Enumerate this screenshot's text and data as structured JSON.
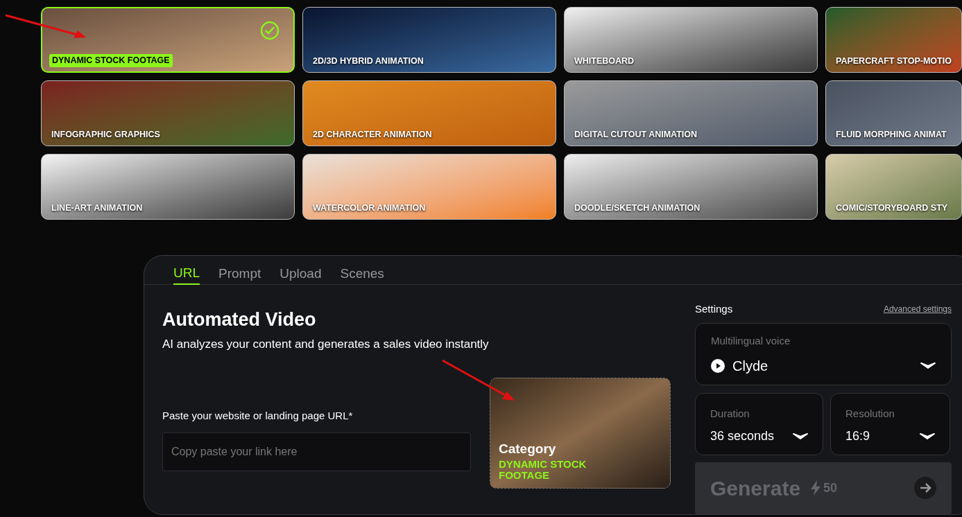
{
  "styles": [
    {
      "label": "DYNAMIC STOCK FOOTAGE",
      "selected": true
    },
    {
      "label": "2D/3D HYBRID ANIMATION",
      "selected": false
    },
    {
      "label": "WHITEBOARD",
      "selected": false
    },
    {
      "label": "PAPERCRAFT STOP-MOTIO",
      "selected": false
    },
    {
      "label": "INFOGRAPHIC GRAPHICS",
      "selected": false
    },
    {
      "label": "2D CHARACTER ANIMATION",
      "selected": false
    },
    {
      "label": "DIGITAL CUTOUT ANIMATION",
      "selected": false
    },
    {
      "label": "FLUID MORPHING ANIMAT",
      "selected": false
    },
    {
      "label": "LINE-ART ANIMATION",
      "selected": false
    },
    {
      "label": "WATERCOLOR ANIMATION",
      "selected": false
    },
    {
      "label": "DOODLE/SKETCH ANIMATION",
      "selected": false
    },
    {
      "label": "COMIC/STORYBOARD STY",
      "selected": false
    }
  ],
  "tabs": [
    {
      "label": "URL",
      "selected": true
    },
    {
      "label": "Prompt",
      "selected": false
    },
    {
      "label": "Upload",
      "selected": false
    },
    {
      "label": "Scenes",
      "selected": false
    }
  ],
  "heading": "Automated Video",
  "subheading": "AI analyzes your content and generates a sales video instantly",
  "url_field": {
    "label": "Paste your website or landing page URL*",
    "placeholder": "Copy paste your link here"
  },
  "category": {
    "title": "Category",
    "value": "DYNAMIC STOCK FOOTAGE"
  },
  "settings": {
    "title": "Settings",
    "advanced_link": "Advanced settings",
    "voice": {
      "label": "Multilingual voice",
      "value": "Clyde"
    },
    "duration": {
      "label": "Duration",
      "value": "36 seconds"
    },
    "resolution": {
      "label": "Resolution",
      "value": "16:9"
    },
    "generate": {
      "label": "Generate",
      "cost": "50",
      "disabled": true
    }
  }
}
